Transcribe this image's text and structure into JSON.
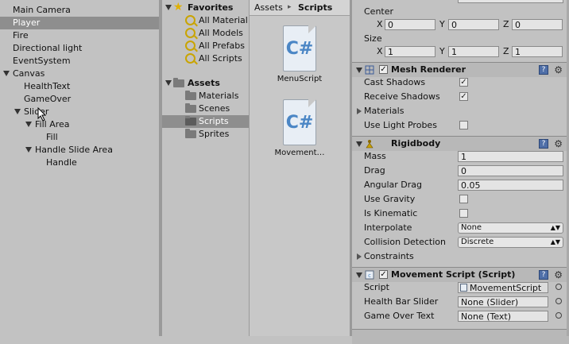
{
  "hierarchy": {
    "items": [
      {
        "label": "Main Camera"
      },
      {
        "label": "Player"
      },
      {
        "label": "Fire"
      },
      {
        "label": "Directional light"
      },
      {
        "label": "EventSystem"
      },
      {
        "label": "Canvas"
      },
      {
        "label": "HealthText"
      },
      {
        "label": "GameOver"
      },
      {
        "label": "Slider"
      },
      {
        "label": "Fill Area"
      },
      {
        "label": "Fill"
      },
      {
        "label": "Handle Slide Area"
      },
      {
        "label": "Handle"
      }
    ]
  },
  "project": {
    "favorites_label": "Favorites",
    "favorites": [
      {
        "label": "All Material"
      },
      {
        "label": "All Models"
      },
      {
        "label": "All Prefabs"
      },
      {
        "label": "All Scripts"
      }
    ],
    "assets_label": "Assets",
    "folders": [
      {
        "label": "Materials"
      },
      {
        "label": "Scenes"
      },
      {
        "label": "Scripts"
      },
      {
        "label": "Sprites"
      }
    ],
    "breadcrumb": {
      "root": "Assets",
      "sep": "▸",
      "current": "Scripts"
    },
    "files": [
      {
        "name": "MenuScript",
        "glyph": "C#"
      },
      {
        "name": "Movement…",
        "glyph": "C#"
      }
    ]
  },
  "inspector": {
    "collider": {
      "center_label": "Center",
      "center": {
        "x": "0",
        "y": "0",
        "z": "0"
      },
      "size_label": "Size",
      "size": {
        "x": "1",
        "y": "1",
        "z": "1"
      },
      "axis_labels": {
        "x": "X",
        "y": "Y",
        "z": "Z"
      }
    },
    "mesh_renderer": {
      "title": "Mesh Renderer",
      "cast_shadows_label": "Cast Shadows",
      "receive_shadows_label": "Receive Shadows",
      "materials_label": "Materials",
      "use_light_probes_label": "Use Light Probes",
      "check": "✓"
    },
    "rigidbody": {
      "title": "Rigidbody",
      "mass_label": "Mass",
      "mass": "1",
      "drag_label": "Drag",
      "drag": "0",
      "angular_drag_label": "Angular Drag",
      "angular_drag": "0.05",
      "use_gravity_label": "Use Gravity",
      "is_kinematic_label": "Is Kinematic",
      "interpolate_label": "Interpolate",
      "interpolate": "None",
      "collision_label": "Collision Detection",
      "collision": "Discrete",
      "constraints_label": "Constraints"
    },
    "movement_script": {
      "title": "Movement Script (Script)",
      "script_label": "Script",
      "script": "MovementScript",
      "health_label": "Health Bar Slider",
      "health": "None (Slider)",
      "gameover_label": "Game Over Text",
      "gameover": "None (Text)"
    },
    "help_glyph": "?",
    "gear_glyph": "⚙",
    "dd_arrow": "▲▼"
  }
}
